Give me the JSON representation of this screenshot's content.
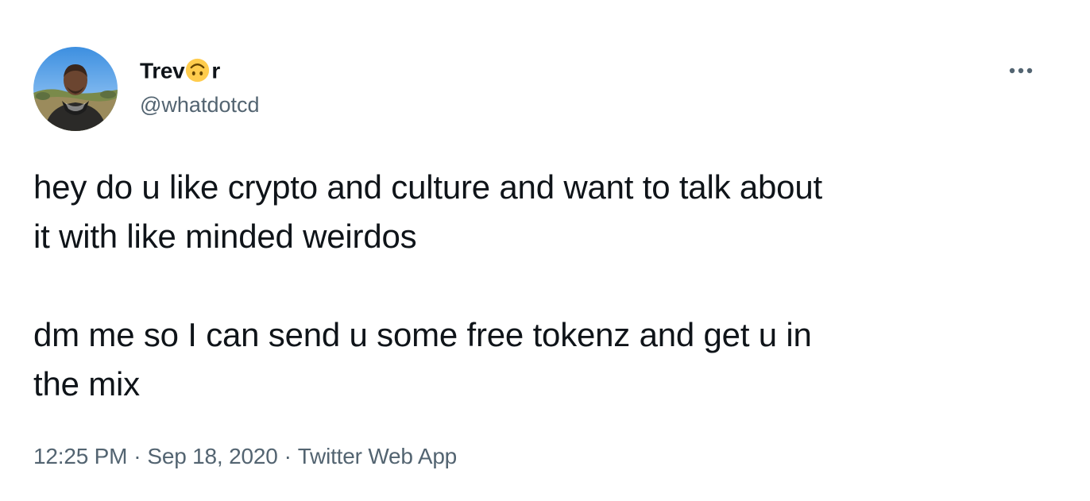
{
  "author": {
    "name_before": "Trev",
    "name_emoji": "upside-down-face-emoji",
    "name_after": "r",
    "handle": "@whatdotcd",
    "avatar_icon": "avatar-photo"
  },
  "more_icon": "more-options-icon",
  "tweet": {
    "paragraphs": [
      "hey do u like crypto and culture and want to talk about\nit with like minded weirdos",
      "dm me so I can send u some free tokenz and get u in\nthe mix"
    ]
  },
  "meta": {
    "time": "12:25 PM",
    "separator": "·",
    "date": "Sep 18, 2020",
    "source": "Twitter Web App"
  },
  "colors": {
    "text": "#0f1419",
    "secondary_text": "#536471",
    "emoji_yellow": "#ffcc4d"
  }
}
